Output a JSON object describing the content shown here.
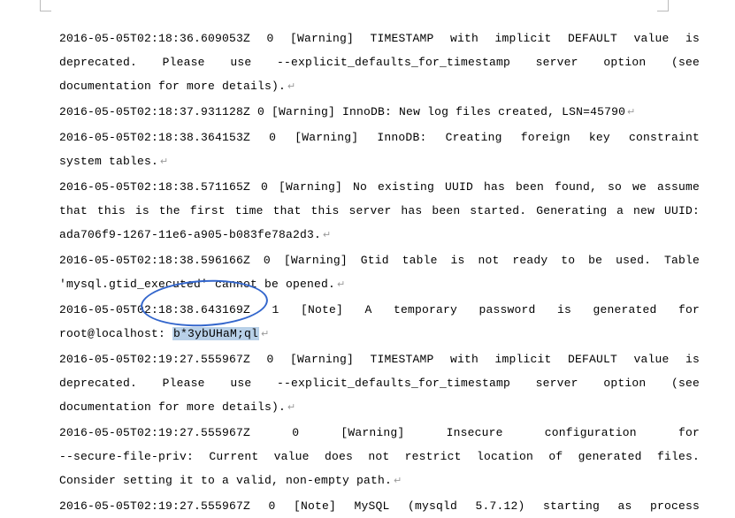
{
  "log": {
    "l1": "2016-05-05T02:18:36.609053Z 0 [Warning] TIMESTAMP with implicit DEFAULT value is",
    "l2": "deprecated.  Please  use  --explicit_defaults_for_timestamp  server  option  (see",
    "l3": "documentation for more details).",
    "l4": "2016-05-05T02:18:37.931128Z 0 [Warning] InnoDB: New log files created, LSN=45790",
    "l5": "2016-05-05T02:18:38.364153Z 0 [Warning] InnoDB: Creating foreign key constraint",
    "l6": "system tables.",
    "l7": "2016-05-05T02:18:38.571165Z 0 [Warning] No existing UUID has been found, so we assume",
    "l8": "that this is the first time that this server has been started. Generating a new UUID:",
    "l9": "ada706f9-1267-11e6-a905-b083fe78a2d3.",
    "l10": "2016-05-05T02:18:38.596166Z 0 [Warning] Gtid table is not ready to be used. Table",
    "l11": "'mysql.gtid_executed' cannot be opened.",
    "l12a": "2016-05-05T02:18:38.643169Z  1  [Note]  A  temporary  password  is  generated  for",
    "l12b_prefix": "root@localhost:",
    "l12b_highlight": "b*3ybUHaM;ql",
    "l13": "2016-05-05T02:19:27.555967Z 0 [Warning] TIMESTAMP with implicit DEFAULT value is",
    "l14": "deprecated.  Please  use  --explicit_defaults_for_timestamp  server  option  (see",
    "l15": "documentation for more details).",
    "l16": "2016-05-05T02:19:27.555967Z    0    [Warning]    Insecure    configuration    for",
    "l17": "--secure-file-priv: Current value does not restrict location of generated files.",
    "l18": "Consider setting it to a valid, non-empty path.",
    "l19": "2016-05-05T02:19:27.555967Z 0 [Note] MySQL (mysqld 5.7.12) starting as process"
  },
  "markers": {
    "ret": "↵"
  }
}
